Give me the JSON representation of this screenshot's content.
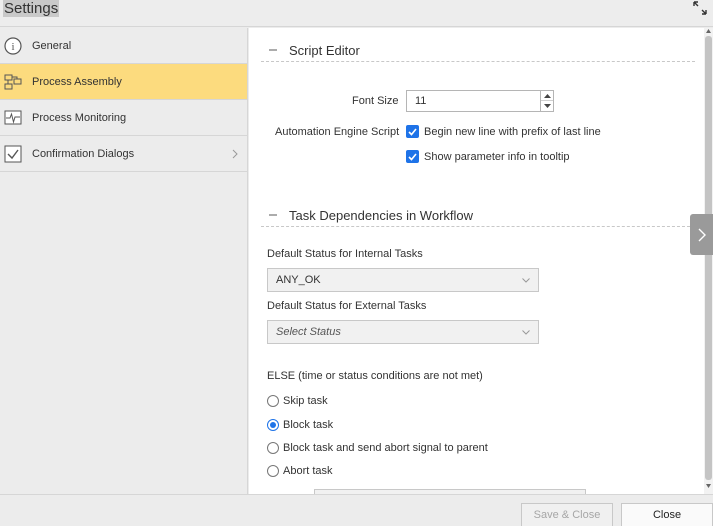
{
  "window": {
    "title": "Settings"
  },
  "sidebar": {
    "items": [
      {
        "label": "General",
        "icon": "info-icon",
        "active": false
      },
      {
        "label": "Process Assembly",
        "icon": "process-assembly-icon",
        "active": true
      },
      {
        "label": "Process Monitoring",
        "icon": "monitor-pulse-icon",
        "active": false
      },
      {
        "label": "Confirmation Dialogs",
        "icon": "checkbox-icon",
        "active": false,
        "has_chevron": true
      }
    ]
  },
  "script_editor": {
    "title": "Script Editor",
    "font_size_label": "Font Size",
    "font_size_value": "11",
    "ae_script_label": "Automation Engine Script",
    "options": [
      {
        "label": "Begin new line with prefix of last line",
        "checked": true
      },
      {
        "label": "Show parameter info in tooltip",
        "checked": true
      }
    ]
  },
  "task_dependencies": {
    "title": "Task Dependencies in Workflow",
    "internal_label": "Default Status for Internal Tasks",
    "internal_value": "ANY_OK",
    "external_label": "Default Status for External Tasks",
    "external_placeholder": "Select Status",
    "else_label": "ELSE (time or status conditions are not met)",
    "else_options": [
      {
        "label": "Skip task",
        "selected": false
      },
      {
        "label": "Block task",
        "selected": true
      },
      {
        "label": "Block task and send abort signal to parent",
        "selected": false
      },
      {
        "label": "Abort task",
        "selected": false
      }
    ]
  },
  "footer": {
    "save_close_label": "Save & Close",
    "close_label": "Close"
  },
  "colors": {
    "accent": "#1e73e8",
    "active_nav": "#fcdb7e"
  }
}
